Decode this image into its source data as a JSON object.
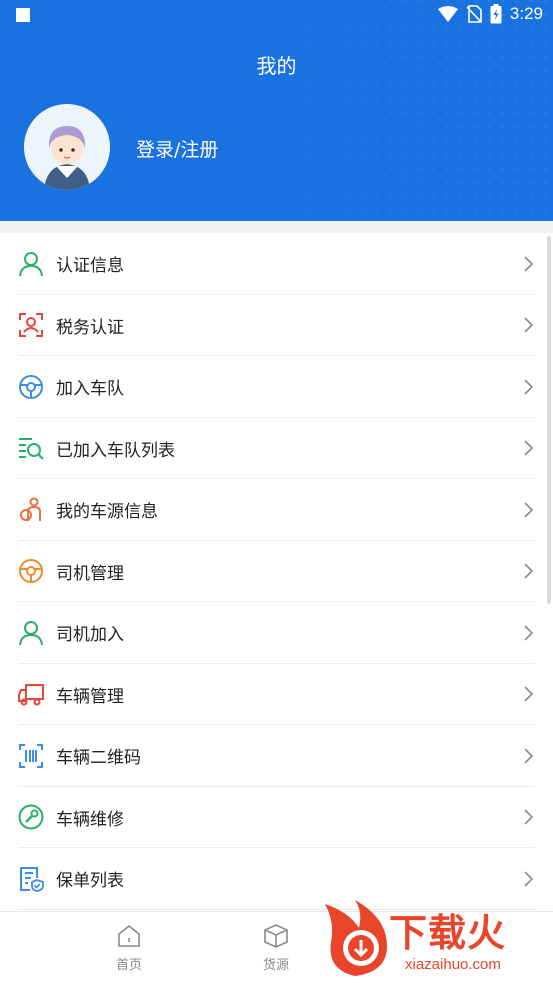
{
  "status": {
    "time": "3:29"
  },
  "header": {
    "title": "我的",
    "login_label": "登录/注册"
  },
  "menu": [
    {
      "label": "认证信息",
      "icon": "user-icon",
      "color": "#2ab06a"
    },
    {
      "label": "税务认证",
      "icon": "face-scan-icon",
      "color": "#e8453c"
    },
    {
      "label": "加入车队",
      "icon": "steering-wheel-icon",
      "color": "#3a8ee6"
    },
    {
      "label": "已加入车队列表",
      "icon": "list-search-icon",
      "color": "#2ab06a"
    },
    {
      "label": "我的车源信息",
      "icon": "driver-icon",
      "color": "#e8713c"
    },
    {
      "label": "司机管理",
      "icon": "steering-wheel-icon",
      "color": "#f08a2c"
    },
    {
      "label": "司机加入",
      "icon": "user-icon",
      "color": "#2ab06a"
    },
    {
      "label": "车辆管理",
      "icon": "truck-icon",
      "color": "#e8453c"
    },
    {
      "label": "车辆二维码",
      "icon": "barcode-icon",
      "color": "#3a8ee6"
    },
    {
      "label": "车辆维修",
      "icon": "wrench-icon",
      "color": "#2ab06a"
    },
    {
      "label": "保单列表",
      "icon": "document-shield-icon",
      "color": "#3a8ee6"
    }
  ],
  "bottom_nav": [
    {
      "label": "首页",
      "icon": "home-icon"
    },
    {
      "label": "货源",
      "icon": "box-icon"
    }
  ],
  "watermark": {
    "text": "下载火",
    "url": "xiazaihuo.com"
  },
  "colors": {
    "header": "#1a72e0",
    "accent_red": "#e8452a"
  }
}
